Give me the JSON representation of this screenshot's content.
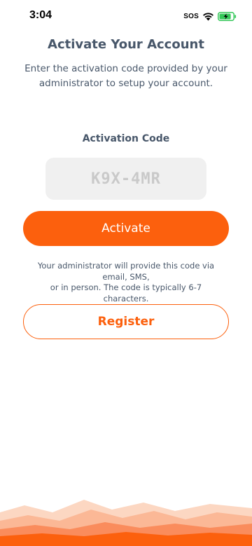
{
  "status_bar": {
    "time": "3:04",
    "sos": "SOS",
    "battery_level": 0.85,
    "battery_color": "#34c759"
  },
  "header": {
    "title": "Activate Your Account",
    "subtitle": "Enter the activation code provided by your administrator to setup your account."
  },
  "form": {
    "code_label": "Activation Code",
    "code_value": "",
    "code_placeholder": "K9X-4MR",
    "activate_label": "Activate"
  },
  "helper": {
    "line1": "Your administrator will provide this code via",
    "line2": "email, SMS,",
    "line3": "or in person. The code is typically 6-7 characters."
  },
  "register_label": "Register",
  "colors": {
    "accent": "#fc600d",
    "text": "#48576a",
    "input_bg": "#f0f0f0"
  }
}
